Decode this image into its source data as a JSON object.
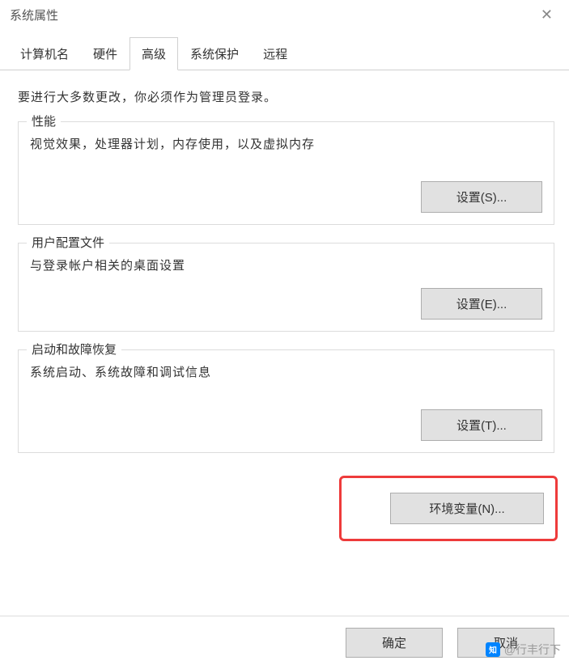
{
  "window_title": "系统属性",
  "tabs": {
    "computer_name": "计算机名",
    "hardware": "硬件",
    "advanced": "高级",
    "system_protection": "系统保护",
    "remote": "远程"
  },
  "intro": "要进行大多数更改，你必须作为管理员登录。",
  "groups": {
    "performance": {
      "legend": "性能",
      "desc": "视觉效果，处理器计划，内存使用，以及虚拟内存",
      "button": "设置(S)..."
    },
    "user_profiles": {
      "legend": "用户配置文件",
      "desc": "与登录帐户相关的桌面设置",
      "button": "设置(E)..."
    },
    "startup": {
      "legend": "启动和故障恢复",
      "desc": "系统启动、系统故障和调试信息",
      "button": "设置(T)..."
    }
  },
  "env_button": "环境变量(N)...",
  "buttons": {
    "ok": "确定",
    "cancel": "取消"
  },
  "watermark": "@行丰行下"
}
